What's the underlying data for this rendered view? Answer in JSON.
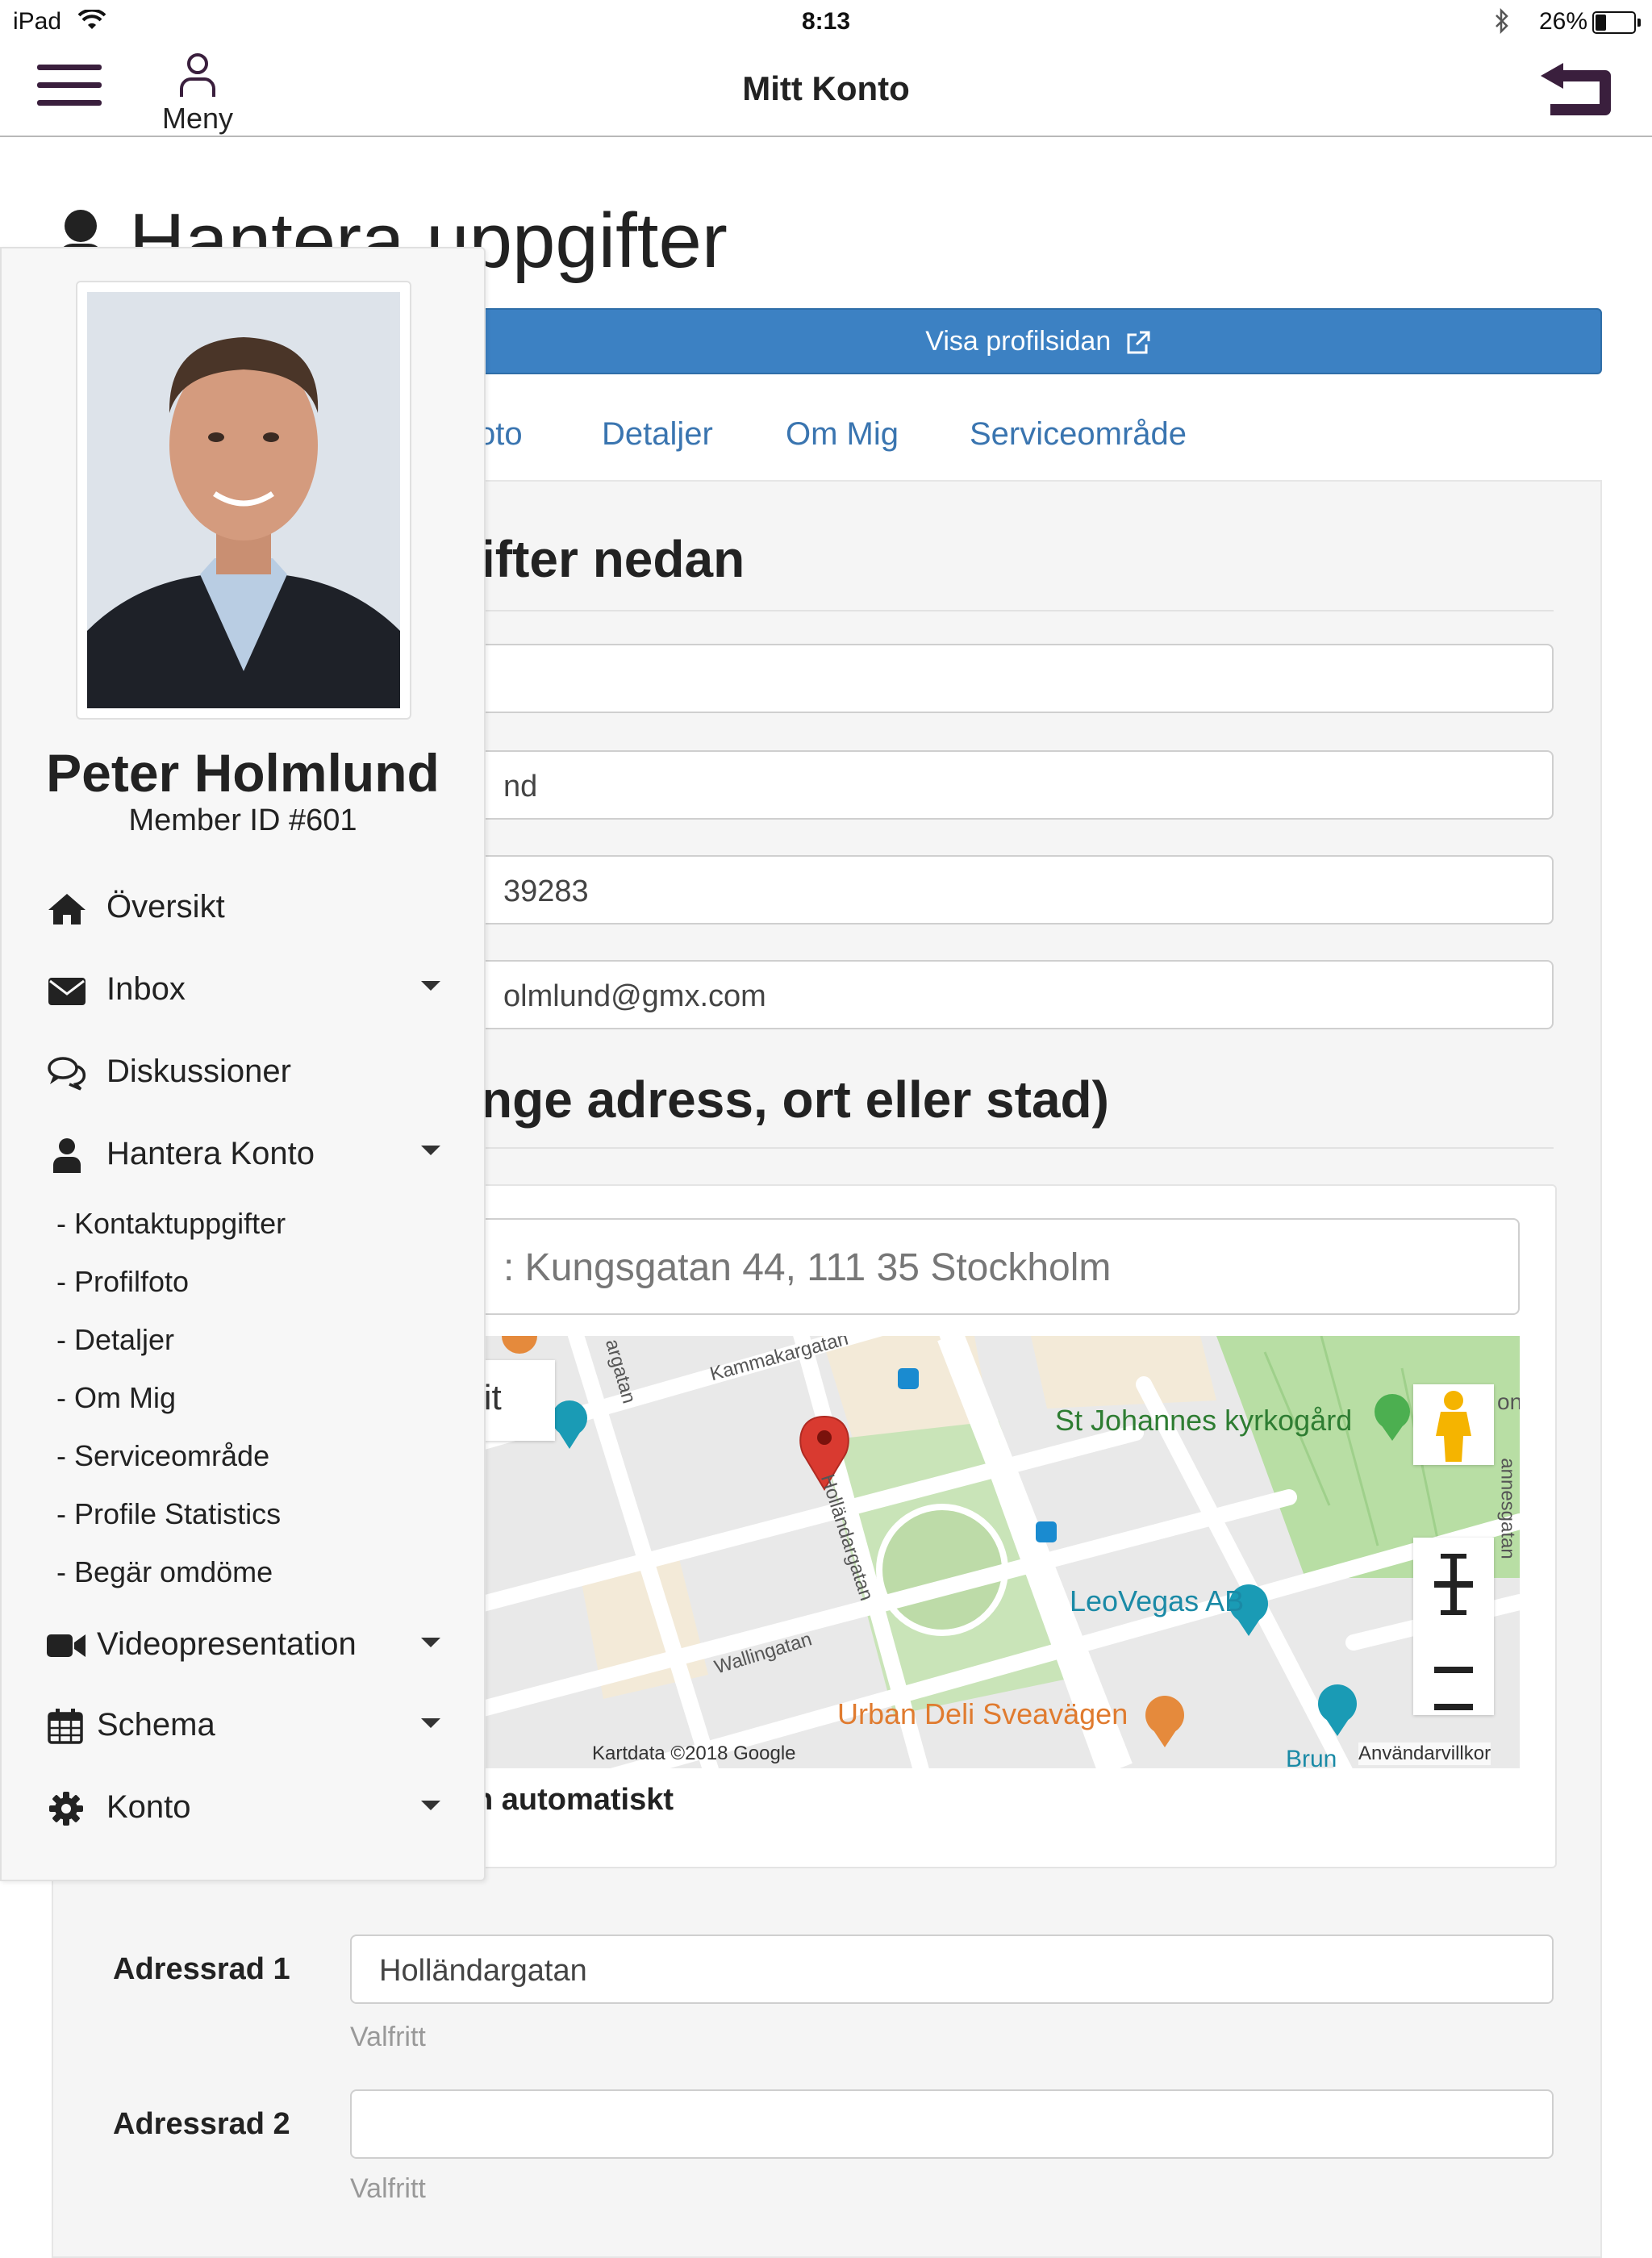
{
  "status_bar": {
    "device": "iPad",
    "time": "8:13",
    "battery": "26%"
  },
  "nav": {
    "menu_label": "Meny",
    "title": "Mitt Konto"
  },
  "page": {
    "title": "Hantera uppgifter",
    "profile_button": "Visa profilsidan",
    "tabs": [
      "oto",
      "Detaljer",
      "Om Mig",
      "Serviceområde"
    ]
  },
  "form": {
    "section1_heading": "ifter nedan",
    "fields": [
      "",
      "nd",
      "39283",
      "olmlund@gmx.com"
    ],
    "section2_heading": "nge adress, ort eller stad)",
    "address_search_placeholder": ": Kungsgatan 44, 111 35 Stockholm",
    "auto_text": "n automatiskt",
    "address1_label": "Adressrad 1",
    "address1_value": "Holländargatan",
    "address1_hint": "Valfritt",
    "address2_label": "Adressrad 2",
    "address2_value": "",
    "address2_hint": "Valfritt"
  },
  "map": {
    "labels": {
      "kammakargatan": "Kammakargatan",
      "st_johannes": "St Johannes kyrkogård",
      "leovegas": "LeoVegas AB",
      "urban_deli": "Urban Deli Sveavägen",
      "wallingatan": "Wallingatan",
      "hollandargatan": "Holländargatan",
      "argatan": "argatan",
      "lit": "lit",
      "brun": "Brun",
      "annesgatan": "annesgatan",
      "on": "on"
    },
    "copyright": "Kartdata ©2018 Google",
    "terms": "Användarvillkor"
  },
  "sidebar": {
    "name": "Peter Holmlund",
    "member_id": "Member ID #601",
    "items": [
      {
        "label": "Översikt",
        "icon": "home-icon"
      },
      {
        "label": "Inbox",
        "icon": "envelope-icon"
      },
      {
        "label": "Diskussioner",
        "icon": "comments-icon"
      },
      {
        "label": "Hantera Konto",
        "icon": "user-icon"
      },
      {
        "label": "Videopresentation",
        "icon": "video-camera-icon"
      },
      {
        "label": "Schema",
        "icon": "calendar-icon"
      },
      {
        "label": "Konto",
        "icon": "gear-icon"
      }
    ],
    "sub_items": [
      "- Kontaktuppgifter",
      "- Profilfoto",
      "- Detaljer",
      "- Om Mig",
      "- Serviceområde",
      "- Profile Statistics",
      "- Begär omdöme"
    ]
  },
  "colors": {
    "primary_button": "#3c81c3",
    "link": "#3a75b0",
    "nav_icon": "#3a1f3d",
    "map_green": "#7cb342",
    "map_orange": "#e58a3c",
    "map_teal": "#1a9bb5",
    "marker_red": "#d93a30"
  }
}
